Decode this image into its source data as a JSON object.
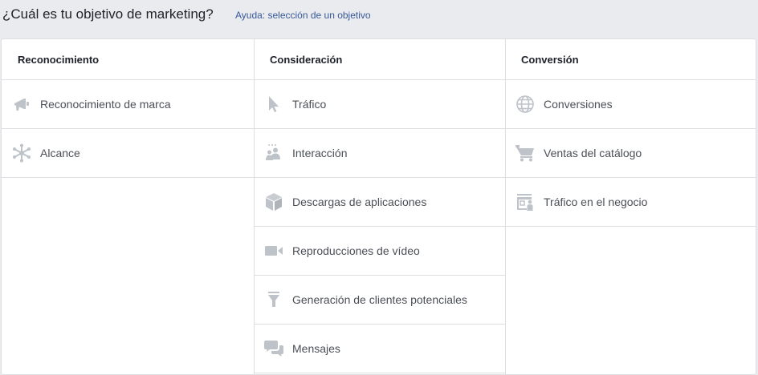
{
  "header": {
    "question": "¿Cuál es tu objetivo de marketing?",
    "help_link": "Ayuda: selección de un objetivo"
  },
  "columns": [
    {
      "title": "Reconocimiento",
      "items": [
        {
          "label": "Reconocimiento de marca",
          "icon": "megaphone-icon"
        },
        {
          "label": "Alcance",
          "icon": "reach-icon"
        }
      ]
    },
    {
      "title": "Consideración",
      "items": [
        {
          "label": "Tráfico",
          "icon": "cursor-icon"
        },
        {
          "label": "Interacción",
          "icon": "people-icon"
        },
        {
          "label": "Descargas de aplicaciones",
          "icon": "box-icon"
        },
        {
          "label": "Reproducciones de vídeo",
          "icon": "video-camera-icon"
        },
        {
          "label": "Generación de clientes potenciales",
          "icon": "funnel-icon"
        },
        {
          "label": "Mensajes",
          "icon": "chat-bubbles-icon"
        }
      ]
    },
    {
      "title": "Conversión",
      "items": [
        {
          "label": "Conversiones",
          "icon": "globe-icon"
        },
        {
          "label": "Ventas del catálogo",
          "icon": "shopping-cart-icon"
        },
        {
          "label": "Tráfico en el negocio",
          "icon": "store-icon"
        }
      ]
    }
  ],
  "colors": {
    "icon": "#bec3c9",
    "link": "#365899",
    "border": "#dddfe2"
  }
}
